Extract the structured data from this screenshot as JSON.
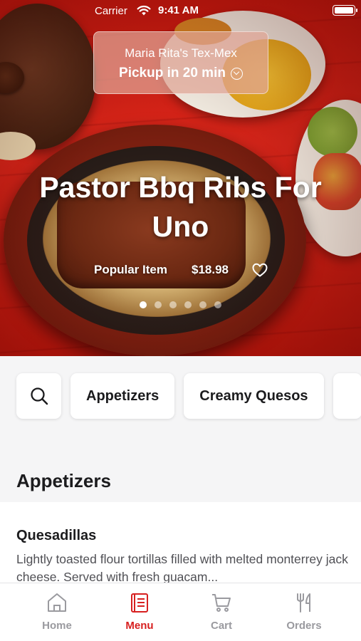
{
  "status_bar": {
    "carrier": "Carrier",
    "time": "9:41 AM"
  },
  "store": {
    "name": "Maria Rita's Tex-Mex",
    "pickup": "Pickup in 20 min"
  },
  "hero": {
    "title": "Pastor Bbq Ribs For Uno",
    "tag": "Popular Item",
    "price": "$18.98",
    "slide_count": 6,
    "active_slide": 1
  },
  "categories": {
    "items": [
      "Appetizers",
      "Creamy Quesos"
    ]
  },
  "section": {
    "title": "Appetizers"
  },
  "menu_item": {
    "name": "Quesadillas",
    "description": "Lightly toasted flour tortillas filled with melted monterrey jack cheese. Served with fresh guacam..."
  },
  "tabs": [
    {
      "label": "Home",
      "icon": "home-icon",
      "active": false
    },
    {
      "label": "Menu",
      "icon": "menu-book-icon",
      "active": true
    },
    {
      "label": "Cart",
      "icon": "cart-icon",
      "active": false
    },
    {
      "label": "Orders",
      "icon": "fork-knife-icon",
      "active": false
    }
  ],
  "colors": {
    "accent": "#d71f1f",
    "inactive_tab": "#9a9a9f"
  }
}
